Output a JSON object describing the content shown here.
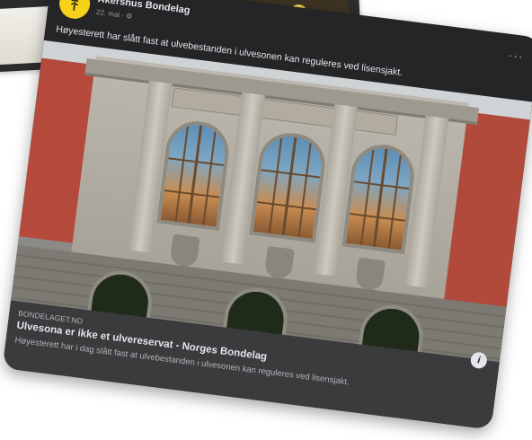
{
  "post": {
    "page_name": "Akershus Bondelag",
    "meta": "22. mai · ⚙",
    "more_label": "···",
    "text": "Høyesterett har slått fast at ulvebestanden i ulvesonen kan reguleres ved lisensjakt."
  },
  "link_preview": {
    "domain": "BONDELAGET.NO",
    "title": "Ulvesona er ikke et ulvereservat - Norges Bondelag",
    "description": "Høyesterett har i dag slått fast at ulvebestanden i ulvesonen kan reguleres ved lisensjakt.",
    "info_label": "i"
  },
  "icons": {
    "avatar": "wheat-logo-icon",
    "more": "more-options-icon",
    "info": "info-icon"
  },
  "colors": {
    "card_bg": "#242526",
    "avatar_yellow": "#f6d21a",
    "text_primary": "#e4e6eb",
    "text_secondary": "#b0b3b8"
  }
}
